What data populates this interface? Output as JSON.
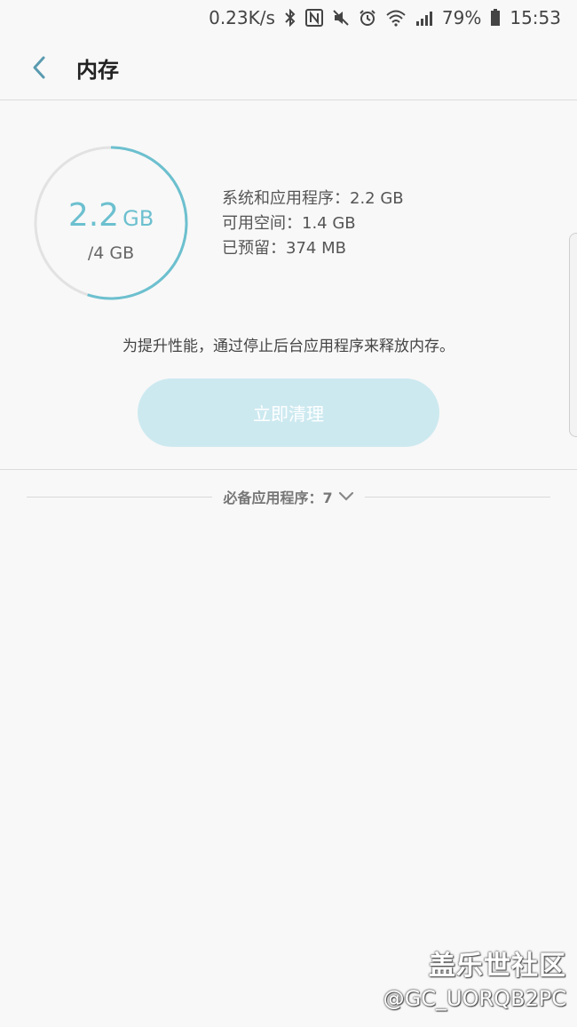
{
  "status": {
    "speed": "0.23K/s",
    "battery": "79%",
    "time": "15:53"
  },
  "header": {
    "title": "内存"
  },
  "memory": {
    "used_value": "2.2",
    "used_unit": "GB",
    "total": "/4 GB",
    "used_fraction": 0.55
  },
  "stats": {
    "system_apps": "系统和应用程序：2.2 GB",
    "available": "可用空间：1.4 GB",
    "reserved": "已预留：374 MB"
  },
  "hint": "为提升性能，通过停止后台应用程序来释放内存。",
  "clean_button": "立即清理",
  "apps_section": {
    "label": "必备应用程序：7"
  },
  "watermark": {
    "title": "盖乐世社区",
    "user": "@GC_UORQB2PC"
  },
  "colors": {
    "accent": "#6cc0cf",
    "button_bg": "#cde9f0",
    "gauge_track": "#e2e2e2"
  }
}
